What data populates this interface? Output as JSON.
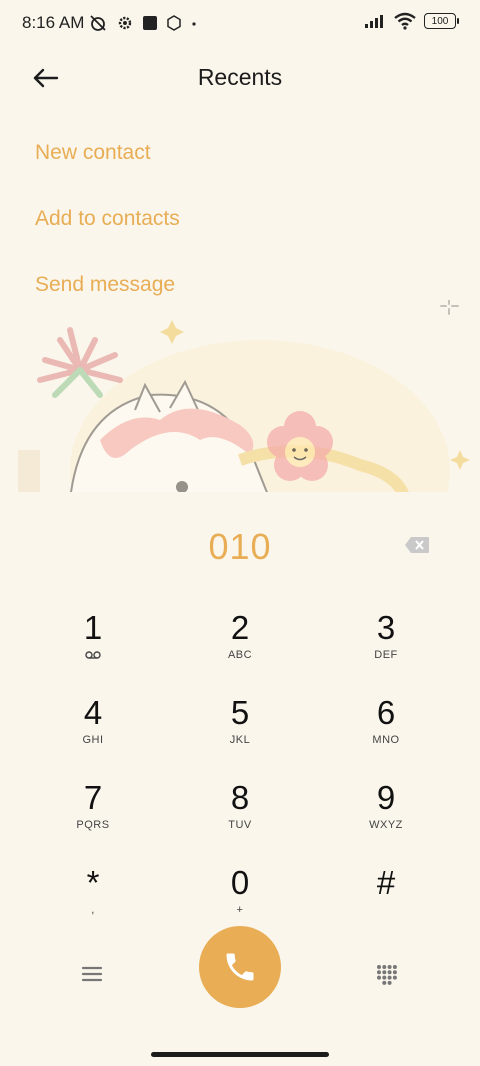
{
  "status": {
    "time": "8:16 AM",
    "battery": "100"
  },
  "header": {
    "title": "Recents"
  },
  "actions": [
    "New contact",
    "Add to contacts",
    "Send message"
  ],
  "dial": {
    "number": "010"
  },
  "keys": [
    {
      "digit": "1",
      "letters": "ꝏ"
    },
    {
      "digit": "2",
      "letters": "ABC"
    },
    {
      "digit": "3",
      "letters": "DEF"
    },
    {
      "digit": "4",
      "letters": "GHI"
    },
    {
      "digit": "5",
      "letters": "JKL"
    },
    {
      "digit": "6",
      "letters": "MNO"
    },
    {
      "digit": "7",
      "letters": "PQRS"
    },
    {
      "digit": "8",
      "letters": "TUV"
    },
    {
      "digit": "9",
      "letters": "WXYZ"
    },
    {
      "digit": "*",
      "letters": ","
    },
    {
      "digit": "0",
      "letters": "+"
    },
    {
      "digit": "#",
      "letters": ""
    }
  ],
  "colors": {
    "accent": "#E8AD55",
    "background": "#FAF6EC"
  }
}
